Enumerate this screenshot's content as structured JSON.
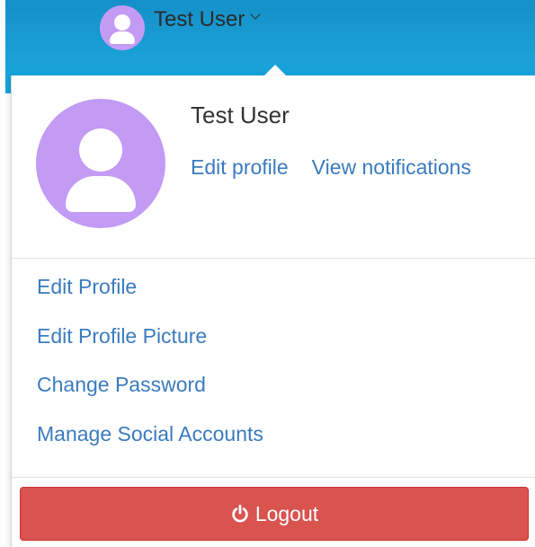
{
  "header": {
    "user_name": "Test User",
    "avatar_icon": "user-icon",
    "toggle_icon": "chevron-down-icon"
  },
  "profile": {
    "name": "Test User",
    "edit_profile_link": "Edit profile",
    "view_notifications_link": "View notifications",
    "avatar_color": "#c39bf5"
  },
  "menu": {
    "items": [
      {
        "label": "Edit Profile"
      },
      {
        "label": "Edit Profile Picture"
      },
      {
        "label": "Change Password"
      },
      {
        "label": "Manage Social Accounts"
      }
    ]
  },
  "logout": {
    "label": "Logout",
    "icon": "power-icon",
    "color": "#d9534f"
  },
  "colors": {
    "header_bg": "#1aa0d6",
    "link": "#3a7bbf"
  }
}
